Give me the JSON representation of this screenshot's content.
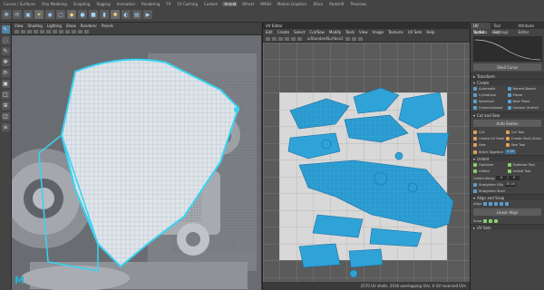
{
  "shelf": {
    "tabs": [
      "Curves / Surfaces",
      "Poly Modeling",
      "Sculpting",
      "Rigging",
      "Animation",
      "Rendering",
      "FX",
      "FX Caching",
      "Custom",
      "Arnold",
      "Bifrost",
      "MASH",
      "Motion Graphics",
      "XGen",
      "Redshift",
      "Previews"
    ],
    "active_index": 9
  },
  "viewport": {
    "menu": [
      "View",
      "Shading",
      "Lighting",
      "Show",
      "Renderer",
      "Panels"
    ],
    "logo": "M"
  },
  "uv_editor": {
    "title": "UV Editor",
    "menu": [
      "Edit",
      "Create",
      "Select",
      "Cut/Sew",
      "Modify",
      "Tools",
      "View",
      "Image",
      "Textures",
      "UV Sets",
      "Help"
    ],
    "texture_label": "aiStandardSurface1",
    "status": "2570 UV shells, 2016 overlapping UVs, 0 UV reversed UVs"
  },
  "uv_toolkit": {
    "tabs": [
      "UV Toolkit",
      "Tool Settings",
      "Attribute Editor"
    ],
    "active_tab": 0,
    "menu": [
      "Options",
      "Help"
    ],
    "soft_label": "Shell Curve",
    "sections": {
      "transform": "Transform",
      "create": "Create",
      "cut_and_sew": "Cut and Sew",
      "unfold": "Unfold",
      "align_and_snap": "Align and Snap",
      "uv_sets": "UV Sets"
    },
    "create_items": [
      "Automatic",
      "Normal-Based",
      "Cylindrical",
      "Planar",
      "Spherical",
      "Best Plane",
      "Camera-Based",
      "Contour Stretch"
    ],
    "auto_seams": "Auto Seams",
    "cut_items": [
      "Cut",
      "Cut Tool",
      "Create UV Shell",
      "Create Shell (Grid)",
      "Sew",
      "Sew Tool",
      "Stitch Together"
    ],
    "stitch_value": "0.00",
    "unfold_items": [
      "Optimize",
      "Optimize Tool",
      "Unfold",
      "Unfold Tool",
      "Unfold Along",
      "Straighten UVs",
      "Straighten Shell"
    ],
    "unfold_u": "U",
    "unfold_v": "V",
    "straighten_value": "30.00",
    "align_label": "Align",
    "linear_align": "Linear Align",
    "snap_label": "Snap"
  },
  "colors": {
    "uv_shell": "#2fa3d8",
    "uv_shell_edge": "#1a6fa0",
    "viewport_bg": "#6b6f74",
    "uv_bg": "#5b5b5b",
    "uv_tile": "#d8d8d8",
    "selection": "#38d3f2"
  }
}
